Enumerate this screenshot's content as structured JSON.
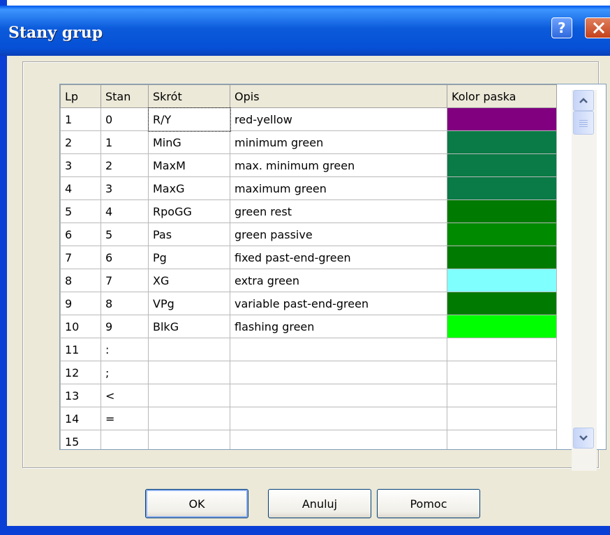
{
  "window": {
    "title": "Stany grup"
  },
  "grid": {
    "columns": [
      "Lp",
      "Stan",
      "Skrót",
      "Opis",
      "Kolor paska"
    ],
    "rows": [
      {
        "lp": "1",
        "stan": "0",
        "skrot": "R/Y",
        "opis": "red-yellow",
        "color": "#800080"
      },
      {
        "lp": "2",
        "stan": "1",
        "skrot": "MinG",
        "opis": "minimum green",
        "color": "#0A7A46"
      },
      {
        "lp": "3",
        "stan": "2",
        "skrot": "MaxM",
        "opis": "max. minimum green",
        "color": "#0A7A46"
      },
      {
        "lp": "4",
        "stan": "3",
        "skrot": "MaxG",
        "opis": "maximum green",
        "color": "#0A7A46"
      },
      {
        "lp": "5",
        "stan": "4",
        "skrot": "RpoGG",
        "opis": "green rest",
        "color": "#007A00"
      },
      {
        "lp": "6",
        "stan": "5",
        "skrot": "Pas",
        "opis": "green passive",
        "color": "#008A00"
      },
      {
        "lp": "7",
        "stan": "6",
        "skrot": "Pg",
        "opis": "fixed past-end-green",
        "color": "#007A00"
      },
      {
        "lp": "8",
        "stan": "7",
        "skrot": "XG",
        "opis": "extra green",
        "color": "#80FFFF"
      },
      {
        "lp": "9",
        "stan": "8",
        "skrot": "VPg",
        "opis": "variable past-end-green",
        "color": "#007A00"
      },
      {
        "lp": "10",
        "stan": "9",
        "skrot": "BlkG",
        "opis": "flashing green",
        "color": "#00FF00"
      },
      {
        "lp": "11",
        "stan": ":",
        "skrot": "",
        "opis": "",
        "color": ""
      },
      {
        "lp": "12",
        "stan": ";",
        "skrot": "",
        "opis": "",
        "color": ""
      },
      {
        "lp": "13",
        "stan": "<",
        "skrot": "",
        "opis": "",
        "color": ""
      },
      {
        "lp": "14",
        "stan": "=",
        "skrot": "",
        "opis": "",
        "color": ""
      },
      {
        "lp": "15",
        "stan": "",
        "skrot": "",
        "opis": "",
        "color": ""
      }
    ]
  },
  "buttons": {
    "ok": "OK",
    "cancel": "Anuluj",
    "help": "Pomoc"
  },
  "icons": {
    "help": "question-icon",
    "close": "close-icon",
    "scroll_up": "arrow-up-icon",
    "scroll_down": "arrow-down-icon"
  }
}
